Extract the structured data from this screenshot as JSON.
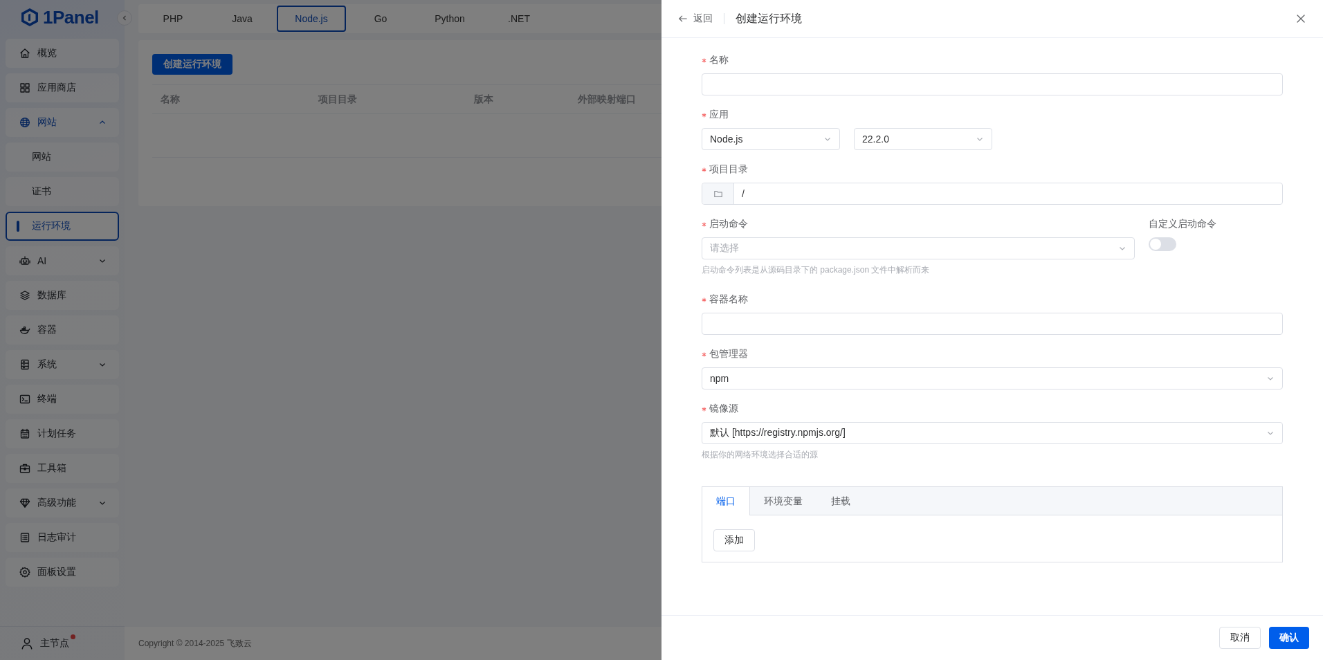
{
  "sidebar": {
    "logo": "1Panel",
    "items": [
      {
        "label": "概览",
        "selected": false
      },
      {
        "label": "应用商店",
        "selected": false
      },
      {
        "label": "网站",
        "selected": false,
        "expanded": true,
        "children": [
          {
            "label": "网站",
            "selected": false
          },
          {
            "label": "证书",
            "selected": false
          },
          {
            "label": "运行环境",
            "selected": true
          }
        ]
      },
      {
        "label": "AI",
        "selected": false,
        "expanded": false
      },
      {
        "label": "数据库",
        "selected": false
      },
      {
        "label": "容器",
        "selected": false
      },
      {
        "label": "系统",
        "selected": false,
        "expanded": false
      },
      {
        "label": "终端",
        "selected": false
      },
      {
        "label": "计划任务",
        "selected": false
      },
      {
        "label": "工具箱",
        "selected": false
      },
      {
        "label": "高级功能",
        "selected": false,
        "expanded": false
      },
      {
        "label": "日志审计",
        "selected": false
      },
      {
        "label": "面板设置",
        "selected": false
      }
    ],
    "node": {
      "label": "主节点",
      "alert": true
    }
  },
  "runtime_tabs": [
    {
      "label": "PHP",
      "selected": false
    },
    {
      "label": "Java",
      "selected": false
    },
    {
      "label": "Node.js",
      "selected": true
    },
    {
      "label": "Go",
      "selected": false
    },
    {
      "label": "Python",
      "selected": false
    },
    {
      "label": ".NET",
      "selected": false
    }
  ],
  "create_button": "创建运行环境",
  "table": {
    "columns": [
      "名称",
      "项目目录",
      "版本",
      "外部映射端口"
    ]
  },
  "footer": "Copyright © 2014-2025 飞致云",
  "drawer": {
    "back": "返回",
    "title": "创建运行环境",
    "form": [
      {
        "kind": "input",
        "label": "名称",
        "required": true
      },
      {
        "kind": "select_pair",
        "label": "应用",
        "required": true,
        "values": [
          "Node.js",
          "22.2.0"
        ]
      },
      {
        "kind": "path",
        "label": "项目目录",
        "required": true,
        "value": "/"
      },
      {
        "kind": "select",
        "label": "启动命令",
        "required": true,
        "placeholder": "请选择",
        "hint": "启动命令列表是从源码目录下的 package.json 文件中解析而来",
        "switch": {
          "label": "自定义启动命令",
          "on": false
        }
      },
      {
        "kind": "input",
        "label": "容器名称",
        "required": true
      },
      {
        "kind": "select",
        "label": "包管理器",
        "required": true,
        "value": "npm"
      },
      {
        "kind": "select",
        "label": "镜像源",
        "required": true,
        "value": "默认 [https://registry.npmjs.org/]",
        "hint": "根据你的网络环境选择合适的源"
      }
    ],
    "tabs": [
      {
        "label": "端口",
        "selected": true
      },
      {
        "label": "环境变量",
        "selected": false
      },
      {
        "label": "挂载",
        "selected": false
      }
    ],
    "add_button": "添加",
    "cancel_button": "取消",
    "confirm_button": "确认"
  }
}
